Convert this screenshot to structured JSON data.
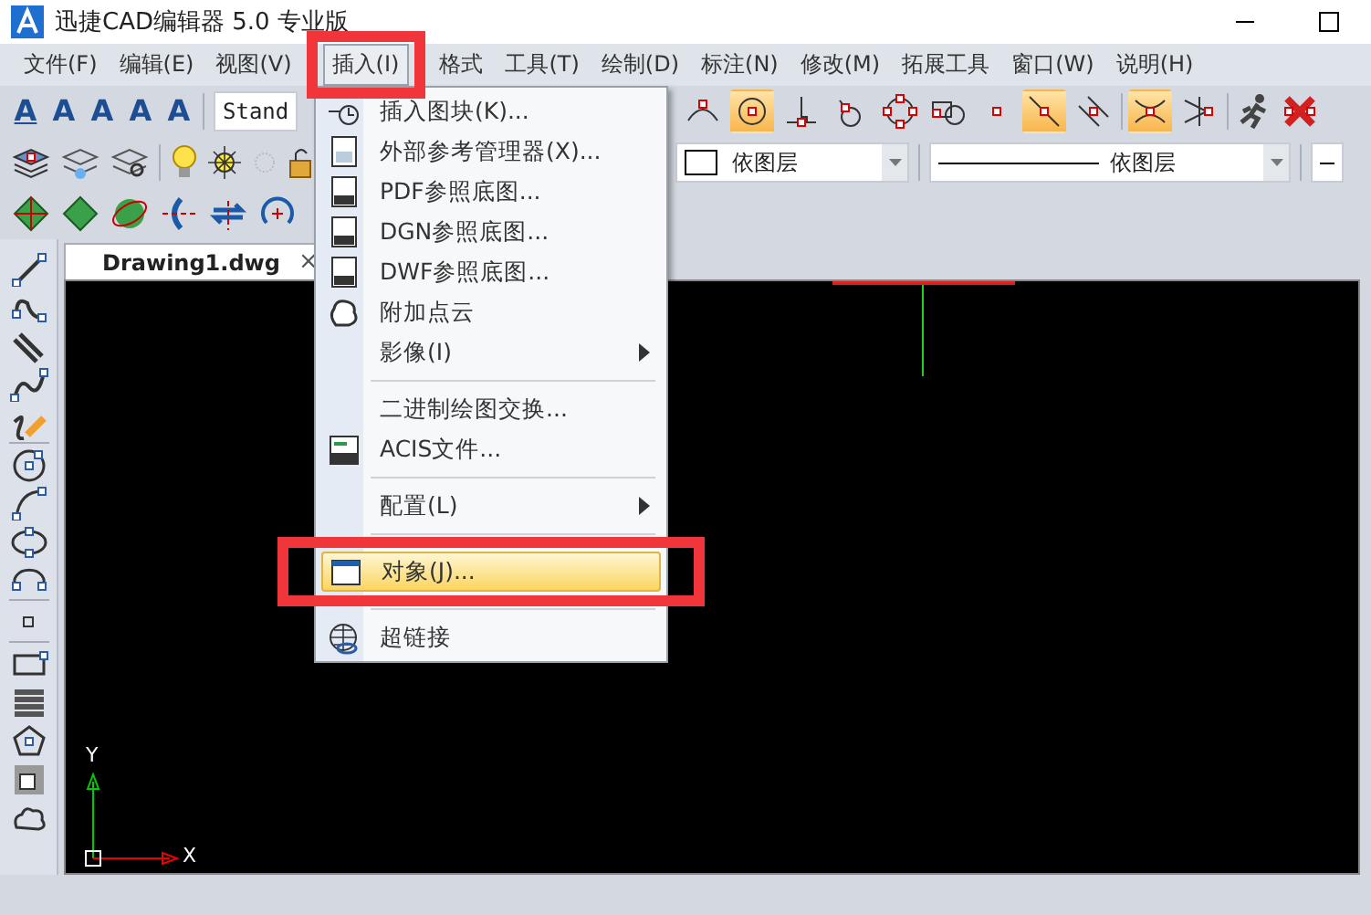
{
  "window": {
    "title": "迅捷CAD编辑器 5.0 专业版"
  },
  "menu_bar": [
    {
      "label": "文件(F)",
      "selected": false
    },
    {
      "label": "编辑(E)",
      "selected": false
    },
    {
      "label": "视图(V)",
      "selected": false
    },
    {
      "label": "插入(I)",
      "selected": true
    },
    {
      "label": "格式",
      "selected": false
    },
    {
      "label": "工具(T)",
      "selected": false
    },
    {
      "label": "绘制(D)",
      "selected": false
    },
    {
      "label": "标注(N)",
      "selected": false
    },
    {
      "label": "修改(M)",
      "selected": false
    },
    {
      "label": "拓展工具",
      "selected": false
    },
    {
      "label": "窗口(W)",
      "selected": false
    },
    {
      "label": "说明(H)",
      "selected": false
    }
  ],
  "text_tools": [
    "A",
    "A",
    "A",
    "A",
    "A"
  ],
  "text_style_combo": "Stand",
  "snap_toggles": [
    {
      "on": false
    },
    {
      "on": true
    },
    {
      "on": false
    },
    {
      "on": false
    },
    {
      "on": false
    },
    {
      "on": false
    },
    {
      "on": false
    },
    {
      "on": true
    },
    {
      "on": false
    },
    {
      "on": true
    },
    {
      "on": false
    }
  ],
  "color_combo": "依图层",
  "linetype_combo": "依图层",
  "drawing_tabs": [
    {
      "label": "Drawing1.dwg",
      "selected": true,
      "close": "×"
    }
  ],
  "insert_menu": [
    {
      "kind": "item",
      "label": "插入图块(K)...",
      "selected": false,
      "submenu": false
    },
    {
      "kind": "item",
      "label": "外部参考管理器(X)...",
      "selected": false,
      "submenu": false
    },
    {
      "kind": "item",
      "label": "PDF参照底图...",
      "selected": false,
      "submenu": false
    },
    {
      "kind": "item",
      "label": "DGN参照底图...",
      "selected": false,
      "submenu": false
    },
    {
      "kind": "item",
      "label": "DWF参照底图...",
      "selected": false,
      "submenu": false
    },
    {
      "kind": "item",
      "label": "附加点云",
      "selected": false,
      "submenu": false
    },
    {
      "kind": "item",
      "label": "影像(I)",
      "selected": false,
      "submenu": true
    },
    {
      "kind": "separator"
    },
    {
      "kind": "item",
      "label": "二进制绘图交换...",
      "selected": false,
      "submenu": false
    },
    {
      "kind": "item",
      "label": "ACIS文件...",
      "selected": false,
      "submenu": false
    },
    {
      "kind": "separator"
    },
    {
      "kind": "item",
      "label": "配置(L)",
      "selected": false,
      "submenu": true
    },
    {
      "kind": "separator"
    },
    {
      "kind": "item",
      "label": "对象(J)...",
      "selected": true,
      "submenu": false
    },
    {
      "kind": "separator"
    },
    {
      "kind": "item",
      "label": "超链接",
      "selected": false,
      "submenu": false
    }
  ],
  "ucs": {
    "y_label": "Y",
    "x_label": "X"
  }
}
